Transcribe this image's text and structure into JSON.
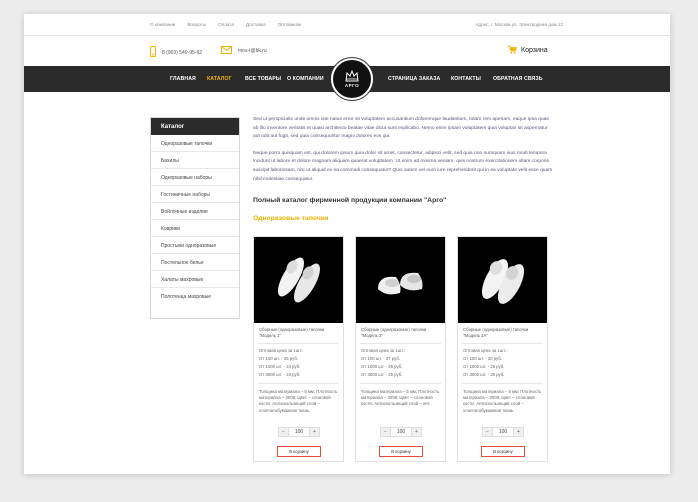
{
  "topbar": {
    "links": [
      "О компании",
      "Вопросы",
      "Оплата",
      "Доставка",
      "Оптовикам"
    ],
    "address": "Адрес: г. Москва ул. Электродная дом 13"
  },
  "header": {
    "phone": "8 (903) 540-95-92",
    "email": "mos-t@bk.ru",
    "cart_label": "Корзина",
    "accent_color": "#f0b400"
  },
  "nav": {
    "items": [
      "Главная",
      "Каталог",
      "Все товары",
      "О компании",
      "Страница заказа",
      "Контакты",
      "Обратная связь"
    ],
    "active_index": 1,
    "logo_text": "АРГО"
  },
  "sidebar": {
    "title": "Каталог",
    "items": [
      "Одноразовые тапочки",
      "Бахилы",
      "Одноразовые наборы",
      "Гостиничные наборы",
      "Войлочные изделия",
      "Коврики",
      "Простыни одноразовые",
      "Постельное белье",
      "Халаты махровые",
      "Полотенца махровые"
    ]
  },
  "content": {
    "para1": "Sed ut perspiciatis unde omnis iste natus error sit voluptatem accusantium doloremque laudantium, totam rem aperiam, eaque ipsa quae ab illo inventore veritatis et quasi architecto beatae vitae dicta sunt explicabo. Nemo enim ipsam voluptatem quia voluptas sit aspernatur aut odit aut fugit, sed quia consequuntur magni dolores eos qui.",
    "para2": "Neque porro quisquam est, qui dolorem ipsum quia dolor sit amet, consectetur, adipisci velit, sed quia non numquam eius modi tempora incidunt ut labore et dolore magnam aliquam quaerat voluptatem. Ut enim ad minima veniam, quis nostrum exercitationem ullam corporis suscipit laboriosam, nisi ut aliquid ex ea commodi consequatur? Quis autem vel eum iure reprehenderit qui in ea voluptate velit esse quam nihil molestiae consequatur.",
    "catalog_title": "Полный каталог фирменной продукции компании \"Арго\"",
    "section_title": "Одноразовые тапочки"
  },
  "products": [
    {
      "name": "Сборные (одноразовые) тапочки \"Модель 1\"",
      "price_title": "Оптовая цена за 1шт.:",
      "prices": [
        "От 100 шт. - 25 руб.",
        "От 1000 шт. - 24 руб.",
        "От 3000 шт. - 23 руб."
      ],
      "description": "Толщина материала – 5 мм; Плотность материала – 3008; Цвет – слоновой кости; Антискользящий слой – хлопчатобумажная ткань.",
      "qty": "100",
      "buy_label": "В корзину"
    },
    {
      "name": "Сборные (одноразовые) тапочки \"Модель 2\"",
      "price_title": "Оптовая цена за 1шт.:",
      "prices": [
        "От 100 шт. - 27 руб.",
        "От 1000 шт. - 26 руб.",
        "От 3000 шт. - 25 руб."
      ],
      "description": "Толщина материала – 5 мм; Плотность материала – 3008; Цвет – слоновой кости; Антискользящий слой – нет.",
      "qty": "100",
      "buy_label": "В корзину"
    },
    {
      "name": "Сборные (одноразовые) тапочки \"Модель 2А\"",
      "price_title": "Оптовая цена за 1шт.:",
      "prices": [
        "От 100 шт. - 30 руб.",
        "От 1000 шт. - 29 руб.",
        "От 3000 шт. - 28 руб."
      ],
      "description": "Толщина материала – 8 мм; Плотность материала – 3008; Цвет – слоновой кости; Антискользящий слой – хлопчатобумажная ткань.",
      "qty": "100",
      "buy_label": "В корзину"
    }
  ],
  "icons": {
    "phone": "phone-icon",
    "email": "envelope-icon",
    "cart": "cart-icon"
  }
}
